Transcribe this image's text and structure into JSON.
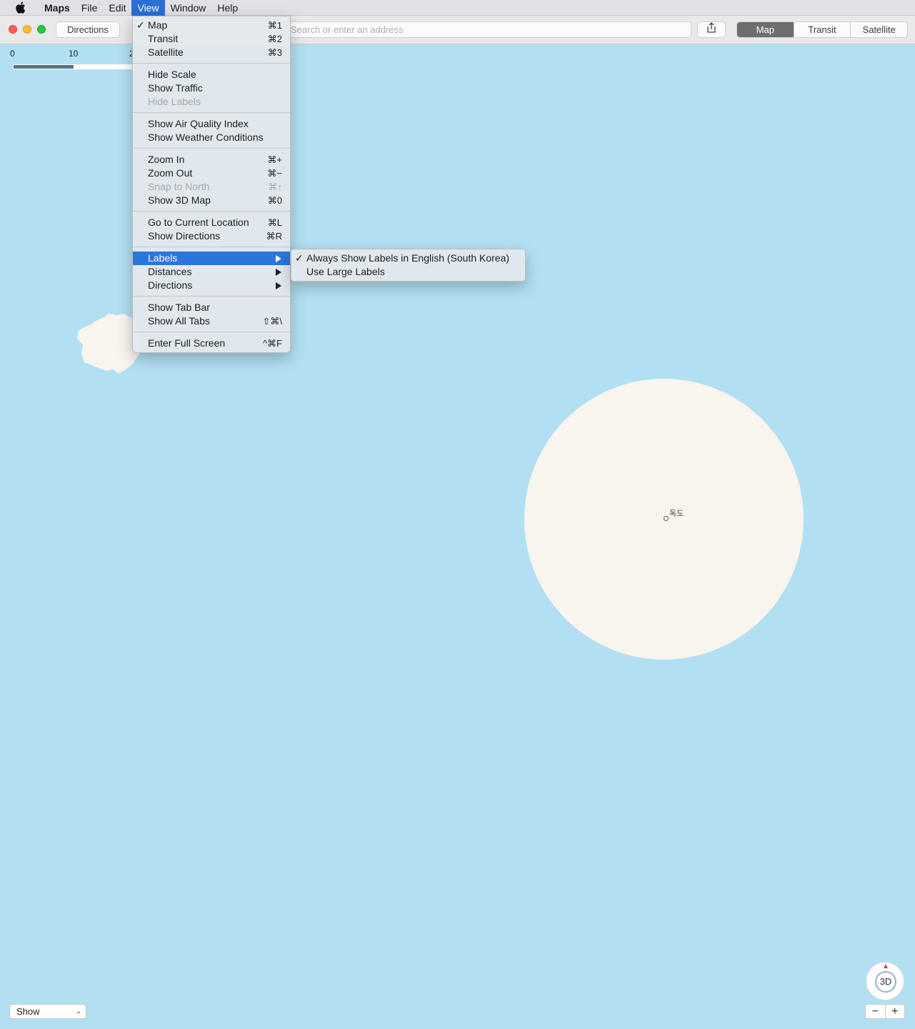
{
  "menubar": {
    "app": "Maps",
    "items": [
      "File",
      "Edit",
      "View",
      "Window",
      "Help"
    ],
    "active": "View"
  },
  "toolbar": {
    "directions_label": "Directions",
    "search_placeholder": "Search or enter an address",
    "map_modes": [
      "Map",
      "Transit",
      "Satellite"
    ],
    "selected_mode": "Map"
  },
  "scale": {
    "ticks": [
      "0",
      "10",
      "2"
    ],
    "fill_fraction": 0.5
  },
  "map": {
    "poi_label": "독도"
  },
  "view_menu": {
    "groups": [
      [
        {
          "label": "Map",
          "shortcut": "⌘1",
          "checked": true
        },
        {
          "label": "Transit",
          "shortcut": "⌘2"
        },
        {
          "label": "Satellite",
          "shortcut": "⌘3"
        }
      ],
      [
        {
          "label": "Hide Scale"
        },
        {
          "label": "Show Traffic"
        },
        {
          "label": "Hide Labels",
          "disabled": true
        }
      ],
      [
        {
          "label": "Show Air Quality Index"
        },
        {
          "label": "Show Weather Conditions"
        }
      ],
      [
        {
          "label": "Zoom In",
          "shortcut": "⌘+"
        },
        {
          "label": "Zoom Out",
          "shortcut": "⌘−"
        },
        {
          "label": "Snap to North",
          "shortcut": "⌘↑",
          "disabled": true
        },
        {
          "label": "Show 3D Map",
          "shortcut": "⌘0"
        }
      ],
      [
        {
          "label": "Go to Current Location",
          "shortcut": "⌘L"
        },
        {
          "label": "Show Directions",
          "shortcut": "⌘R"
        }
      ],
      [
        {
          "label": "Labels",
          "submenu": true,
          "highlighted": true
        },
        {
          "label": "Distances",
          "submenu": true
        },
        {
          "label": "Directions",
          "submenu": true
        }
      ],
      [
        {
          "label": "Show Tab Bar"
        },
        {
          "label": "Show All Tabs",
          "shortcut": "⇧⌘\\"
        }
      ],
      [
        {
          "label": "Enter Full Screen",
          "shortcut": "^⌘F"
        }
      ]
    ]
  },
  "labels_submenu": [
    {
      "label": "Always Show Labels in English (South Korea)",
      "checked": true
    },
    {
      "label": "Use Large Labels"
    }
  ],
  "bottom": {
    "show_label": "Show",
    "compass_label": "3D",
    "zoom_out": "−",
    "zoom_in": "+"
  },
  "colors": {
    "water": "#b2e0f2",
    "land": "#f8f4ee",
    "menu_highlight": "#2a76dc"
  }
}
